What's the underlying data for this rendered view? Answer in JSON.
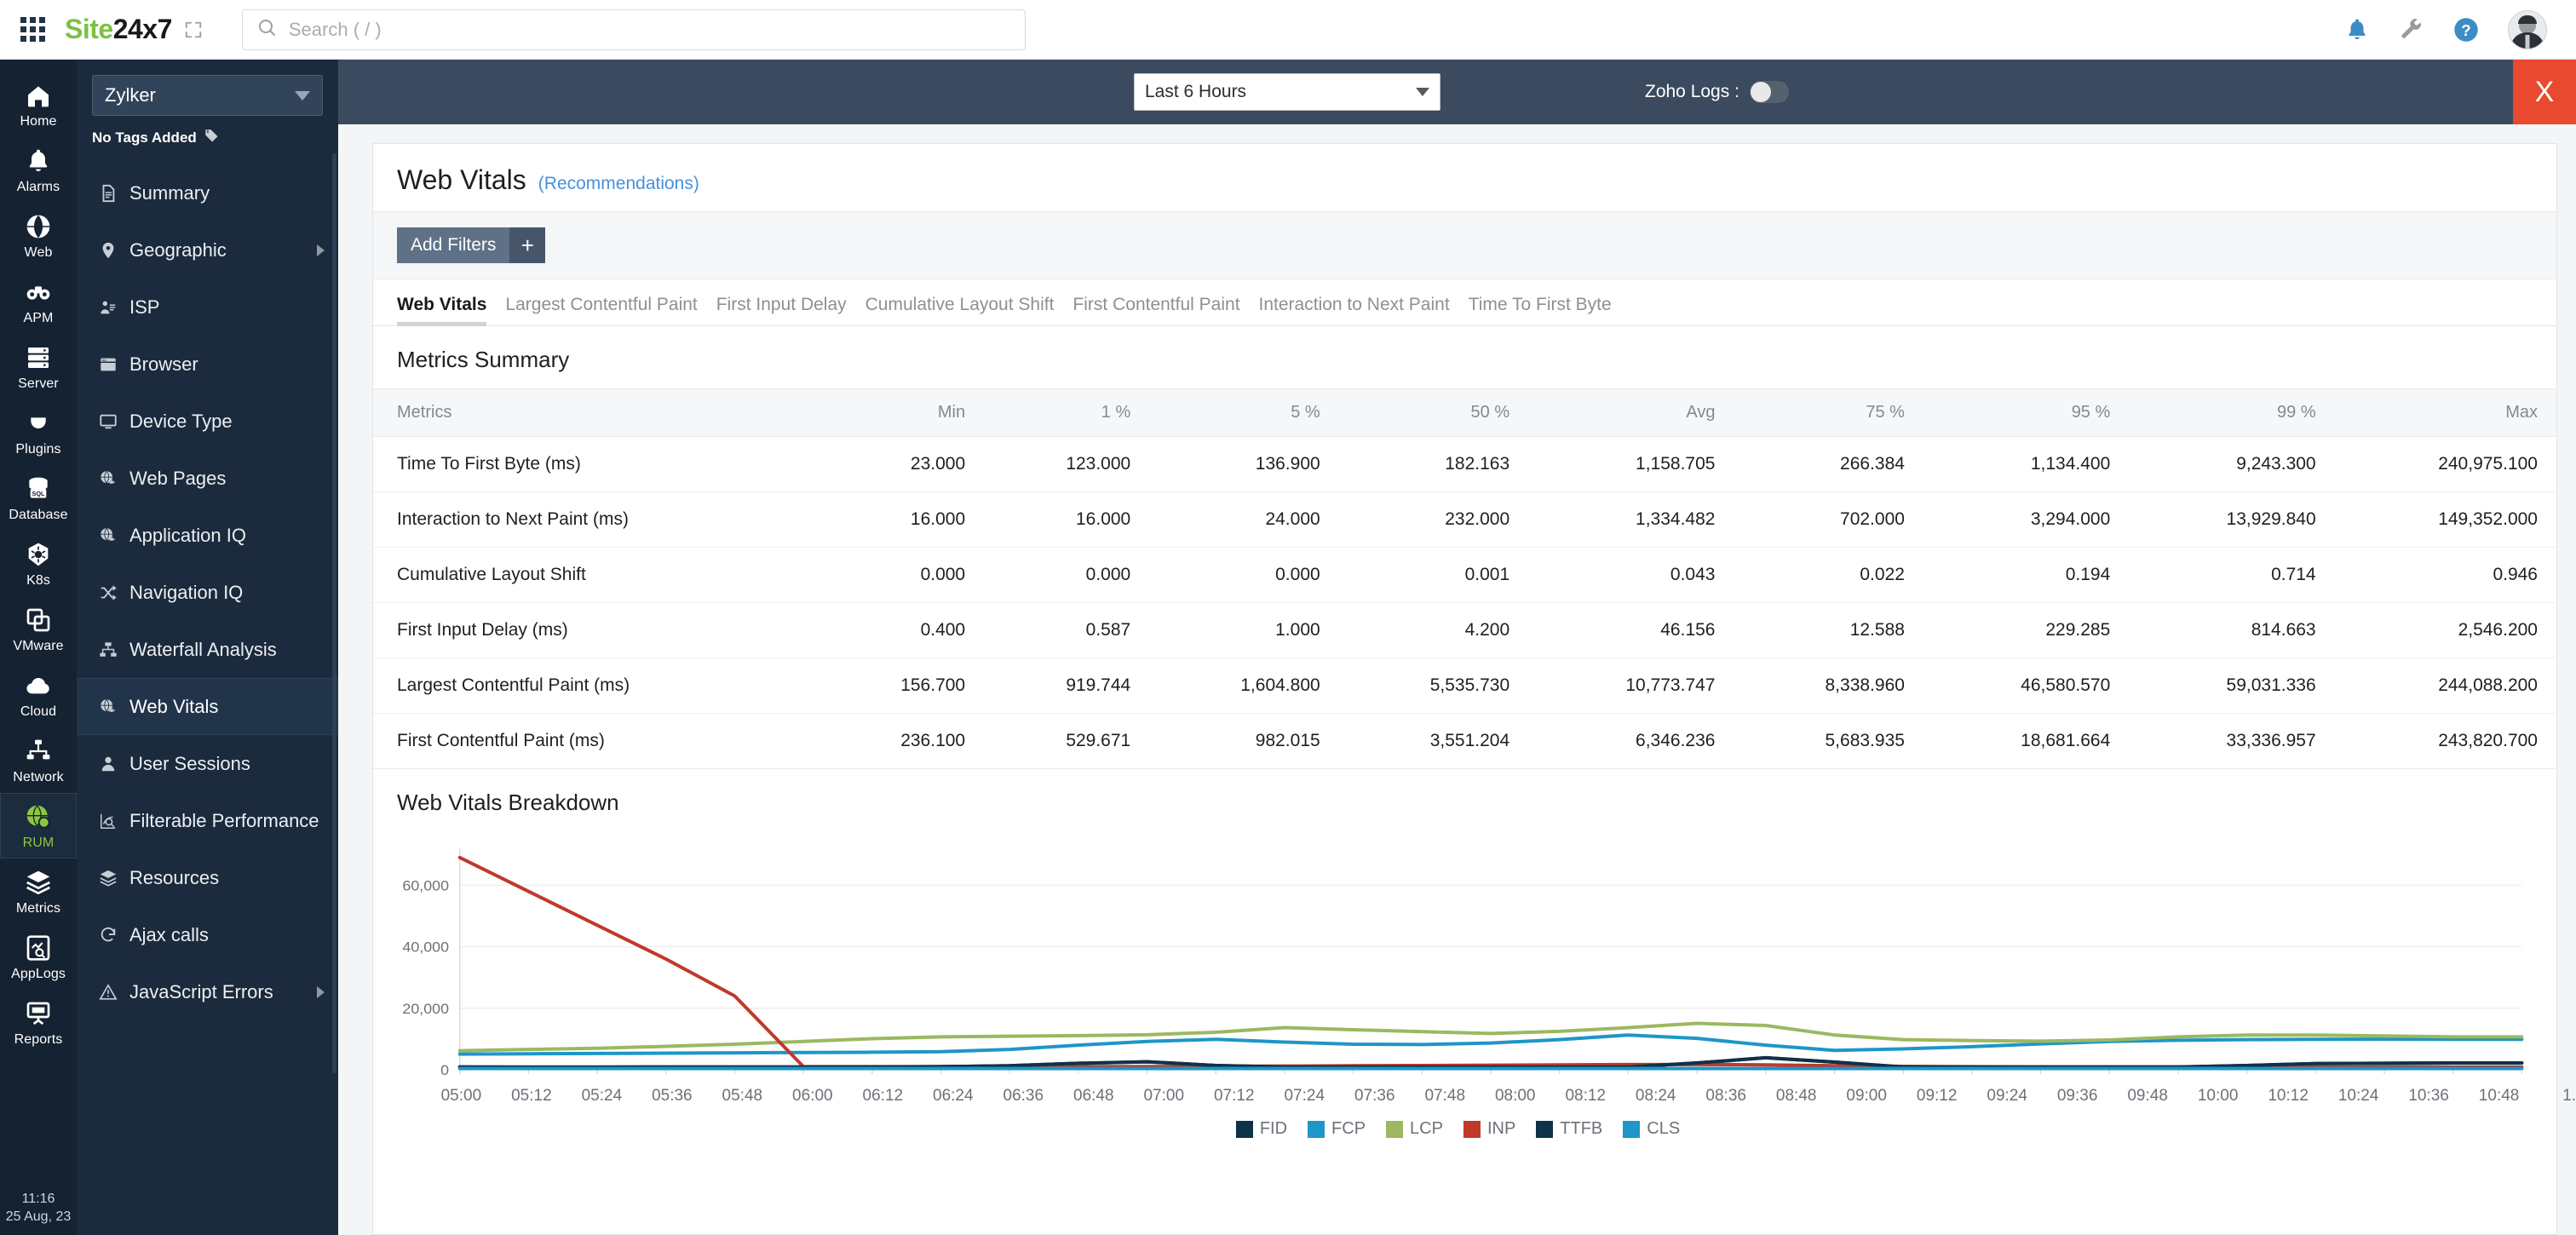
{
  "topbar": {
    "waffle_icon": "apps-grid-icon",
    "brand_green": "Site",
    "brand_dark": "24x7",
    "expand_icon": "expand-icon",
    "search": {
      "placeholder": "Search ( / )",
      "value": "",
      "icon": "search-icon"
    },
    "icons": [
      {
        "name": "bell-icon",
        "label": "Notifications"
      },
      {
        "name": "wrench-icon",
        "label": "Settings"
      },
      {
        "name": "help-icon",
        "label": "Help"
      },
      {
        "name": "avatar",
        "label": "Profile"
      }
    ],
    "colors": {
      "brand_green": "#7cc142",
      "accent_blue": "#3c8dc5",
      "close_red": "#e8492f"
    }
  },
  "rail": {
    "items": [
      {
        "label": "Home",
        "icon": "home-icon",
        "active": false
      },
      {
        "label": "Alarms",
        "icon": "bell-icon",
        "active": false
      },
      {
        "label": "Web",
        "icon": "globe-icon",
        "active": false
      },
      {
        "label": "APM",
        "icon": "binoculars-icon",
        "active": false
      },
      {
        "label": "Server",
        "icon": "server-icon",
        "active": false
      },
      {
        "label": "Plugins",
        "icon": "plug-icon",
        "active": false
      },
      {
        "label": "Database",
        "icon": "database-sql-icon",
        "active": false
      },
      {
        "label": "K8s",
        "icon": "kubernetes-helm-icon",
        "active": false
      },
      {
        "label": "VMware",
        "icon": "windows-stack-icon",
        "active": false
      },
      {
        "label": "Cloud",
        "icon": "cloud-icon",
        "active": false
      },
      {
        "label": "Network",
        "icon": "network-icon",
        "active": false
      },
      {
        "label": "RUM",
        "icon": "globe-search-icon",
        "active": true
      },
      {
        "label": "Metrics",
        "icon": "layers-icon",
        "active": false
      },
      {
        "label": "AppLogs",
        "icon": "log-search-icon",
        "active": false
      },
      {
        "label": "Reports",
        "icon": "presentation-icon",
        "active": false
      }
    ],
    "clock_time": "11:16",
    "clock_date": "25 Aug, 23"
  },
  "subnav": {
    "monitor_name": "Zylker",
    "monitor_caret_icon": "chevron-down-icon",
    "tags_label": "No Tags Added",
    "tags_icon": "tag-icon",
    "items": [
      {
        "label": "Summary",
        "icon": "document-icon",
        "arrow": false,
        "active": false
      },
      {
        "label": "Geographic",
        "icon": "map-pin-icon",
        "arrow": true,
        "active": false
      },
      {
        "label": "ISP",
        "icon": "isp-icon",
        "arrow": false,
        "active": false
      },
      {
        "label": "Browser",
        "icon": "browser-window-icon",
        "arrow": false,
        "active": false
      },
      {
        "label": "Device Type",
        "icon": "monitor-icon",
        "arrow": false,
        "active": false
      },
      {
        "label": "Web Pages",
        "icon": "globe-page-icon",
        "arrow": false,
        "active": false
      },
      {
        "label": "Application IQ",
        "icon": "globe-page-icon",
        "arrow": false,
        "active": false
      },
      {
        "label": "Navigation IQ",
        "icon": "shuffle-icon",
        "arrow": false,
        "active": false
      },
      {
        "label": "Waterfall Analysis",
        "icon": "hierarchy-icon",
        "arrow": false,
        "active": false
      },
      {
        "label": "Web Vitals",
        "icon": "globe-page-icon",
        "arrow": false,
        "active": true
      },
      {
        "label": "User Sessions",
        "icon": "user-icon",
        "arrow": false,
        "active": false
      },
      {
        "label": "Filterable Performance",
        "icon": "chart-search-icon",
        "arrow": false,
        "active": false
      },
      {
        "label": "Resources",
        "icon": "layers-icon",
        "arrow": false,
        "active": false
      },
      {
        "label": "Ajax calls",
        "icon": "refresh-icon",
        "arrow": false,
        "active": false
      },
      {
        "label": "JavaScript Errors",
        "icon": "warning-triangle-icon",
        "arrow": true,
        "active": false
      }
    ]
  },
  "toolbar": {
    "time_range": "Last 6 Hours",
    "time_range_caret_icon": "chevron-down-icon",
    "zoho_logs_label": "Zoho Logs :",
    "zoho_logs_on": false,
    "close_label": "X"
  },
  "page": {
    "title": "Web Vitals",
    "subtitle_link": "(Recommendations)",
    "add_filters_label": "Add Filters",
    "add_filters_plus": "+",
    "tabs": [
      {
        "label": "Web Vitals",
        "active": true
      },
      {
        "label": "Largest Contentful Paint",
        "active": false
      },
      {
        "label": "First Input Delay",
        "active": false
      },
      {
        "label": "Cumulative Layout Shift",
        "active": false
      },
      {
        "label": "First Contentful Paint",
        "active": false
      },
      {
        "label": "Interaction to Next Paint",
        "active": false
      },
      {
        "label": "Time To First Byte",
        "active": false
      }
    ],
    "metrics_summary_title": "Metrics Summary",
    "breakdown_title": "Web Vitals Breakdown"
  },
  "metrics_table": {
    "columns": [
      "Metrics",
      "Min",
      "1 %",
      "5 %",
      "50 %",
      "Avg",
      "75 %",
      "95 %",
      "99 %",
      "Max"
    ],
    "rows": [
      [
        "Time To First Byte (ms)",
        "23.000",
        "123.000",
        "136.900",
        "182.163",
        "1,158.705",
        "266.384",
        "1,134.400",
        "9,243.300",
        "240,975.100"
      ],
      [
        "Interaction to Next Paint (ms)",
        "16.000",
        "16.000",
        "24.000",
        "232.000",
        "1,334.482",
        "702.000",
        "3,294.000",
        "13,929.840",
        "149,352.000"
      ],
      [
        "Cumulative Layout Shift",
        "0.000",
        "0.000",
        "0.000",
        "0.001",
        "0.043",
        "0.022",
        "0.194",
        "0.714",
        "0.946"
      ],
      [
        "First Input Delay (ms)",
        "0.400",
        "0.587",
        "1.000",
        "4.200",
        "46.156",
        "12.588",
        "229.285",
        "814.663",
        "2,546.200"
      ],
      [
        "Largest Contentful Paint (ms)",
        "156.700",
        "919.744",
        "1,604.800",
        "5,535.730",
        "10,773.747",
        "8,338.960",
        "46,580.570",
        "59,031.336",
        "244,088.200"
      ],
      [
        "First Contentful Paint (ms)",
        "236.100",
        "529.671",
        "982.015",
        "3,551.204",
        "6,346.236",
        "5,683.935",
        "18,681.664",
        "33,336.957",
        "243,820.700"
      ]
    ]
  },
  "chart_data": {
    "type": "line",
    "title": "Web Vitals Breakdown",
    "xlabel": "",
    "ylabel": "",
    "ylim": [
      0,
      72000
    ],
    "yticks": [
      0,
      20000,
      40000,
      60000
    ],
    "ytick_labels": [
      "0",
      "20,000",
      "40,000",
      "60,000"
    ],
    "grid": true,
    "legend_position": "bottom",
    "x": [
      "05:00",
      "05:12",
      "05:24",
      "05:36",
      "05:48",
      "06:00",
      "06:12",
      "06:24",
      "06:36",
      "06:48",
      "07:00",
      "07:12",
      "07:24",
      "07:36",
      "07:48",
      "08:00",
      "08:12",
      "08:24",
      "08:36",
      "08:48",
      "09:00",
      "09:12",
      "09:24",
      "09:36",
      "09:48",
      "10:00",
      "10:12",
      "10:24",
      "10:36",
      "10:48",
      "1."
    ],
    "series": [
      {
        "name": "FID",
        "color": "#0e3247",
        "values": [
          900,
          880,
          880,
          900,
          900,
          900,
          950,
          1000,
          1300,
          2100,
          2600,
          1400,
          900,
          900,
          900,
          900,
          900,
          900,
          2200,
          3900,
          2500,
          900,
          900,
          900,
          900,
          900,
          1400,
          2000,
          2100,
          2200,
          2200
        ]
      },
      {
        "name": "FCP",
        "color": "#1e96c8",
        "values": [
          5100,
          5200,
          5300,
          5400,
          5500,
          5600,
          5700,
          5900,
          6600,
          8000,
          9200,
          9900,
          9000,
          8300,
          8200,
          8700,
          9800,
          11300,
          10200,
          8000,
          6300,
          6800,
          7500,
          8400,
          9200,
          9600,
          9800,
          9900,
          9950,
          9900,
          9900
        ]
      },
      {
        "name": "LCP",
        "color": "#9cb860",
        "values": [
          6200,
          6600,
          7000,
          7600,
          8300,
          9200,
          10100,
          10700,
          10900,
          11100,
          11400,
          12200,
          13700,
          13000,
          12400,
          11800,
          12500,
          13700,
          15100,
          14400,
          11300,
          9800,
          9500,
          9300,
          9700,
          10700,
          11300,
          11300,
          11000,
          10700,
          10700
        ]
      },
      {
        "name": "INP",
        "color": "#c0392b",
        "values": [
          69000,
          58000,
          47000,
          36000,
          24000,
          1000,
          1000,
          1000,
          1000,
          1000,
          1050,
          1100,
          1200,
          1300,
          1400,
          1500,
          1600,
          1700,
          1700,
          1600,
          1300,
          1100,
          1000,
          950,
          900,
          900,
          900,
          900,
          900,
          900,
          900
        ]
      },
      {
        "name": "TTFB",
        "color": "#0e3247",
        "values": [
          900,
          880,
          880,
          900,
          900,
          900,
          950,
          1000,
          1300,
          2100,
          2600,
          1400,
          900,
          900,
          900,
          900,
          900,
          900,
          2200,
          3900,
          2500,
          900,
          900,
          900,
          900,
          900,
          1400,
          2000,
          2100,
          2200,
          2200
        ]
      },
      {
        "name": "CLS",
        "color": "#1e96c8",
        "values": [
          400,
          400,
          400,
          400,
          400,
          400,
          400,
          400,
          400,
          400,
          400,
          400,
          400,
          400,
          400,
          400,
          400,
          400,
          400,
          400,
          400,
          400,
          400,
          400,
          400,
          400,
          400,
          400,
          400,
          400,
          400
        ]
      }
    ]
  }
}
